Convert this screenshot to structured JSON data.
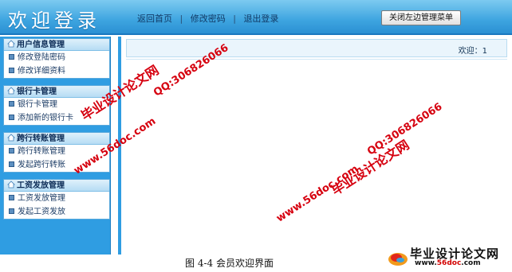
{
  "header": {
    "app_title": "欢迎登录",
    "nav": [
      "返回首页",
      "修改密码",
      "退出登录"
    ],
    "separator": "|",
    "toggle_button": "关闭左边管理菜单"
  },
  "sidebar": {
    "panels": [
      {
        "title": "用户信息管理",
        "items": [
          "修改登陆密码",
          "修改详细资料"
        ]
      },
      {
        "title": "银行卡管理",
        "items": [
          "银行卡管理",
          "添加新的银行卡"
        ]
      },
      {
        "title": "跨行转账管理",
        "items": [
          "跨行转账管理",
          "发起跨行转账"
        ]
      },
      {
        "title": "工资发放管理",
        "items": [
          "工资发放管理",
          "发起工资发放"
        ]
      }
    ]
  },
  "main": {
    "welcome_text": "欢迎：1"
  },
  "watermarks": {
    "site_name_1": "毕业设计论文网",
    "qq_1": "QQ:306826066",
    "url_1": "www.56doc.com",
    "url_2": "www.56doc.com",
    "site_name_2": "毕业设计论文网",
    "qq_2": "QQ:306826066"
  },
  "caption": "图 4-4   会员欢迎界面",
  "logo": {
    "text": "毕业设计论文网",
    "url_prefix": "www.",
    "url_brand": "56doc",
    "url_suffix": ".com"
  },
  "colors": {
    "header_blue": "#3ea5e0",
    "sidebar_blue": "#2f9de2",
    "watermark_red": "#d6000f"
  }
}
